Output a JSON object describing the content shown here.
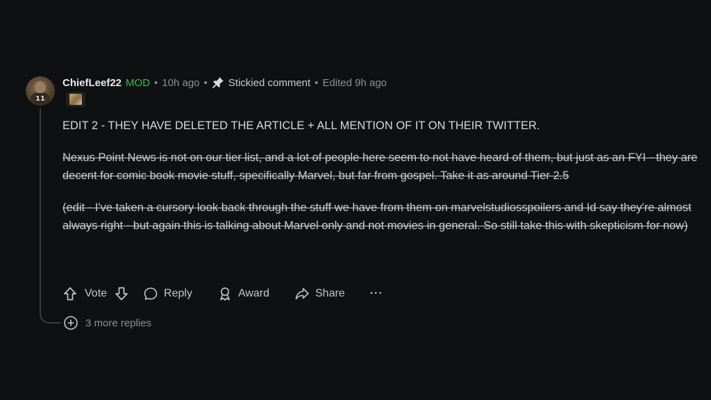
{
  "comment": {
    "author": "ChiefLeef22",
    "role_badge": "MOD",
    "time_ago": "10h ago",
    "stickied_label": "Stickied comment",
    "edited": "Edited 9h ago",
    "separator": "•",
    "paragraphs": [
      "EDIT 2 - THEY HAVE DELETED THE ARTICLE + ALL MENTION OF IT ON THEIR TWITTER.",
      "Nexus Point News is not on our tier list, and a lot of people here seem to not have heard of them, but just as an FYI - they are decent for comic book movie stuff, specifically Marvel, but far from gospel. Take it as around Tier 2.5",
      "(edit - I've taken a cursory look back through the stuff we have from them on marvelstudiosspoilers and Id say they're almost always right - but again this is talking about Marvel only and not movies in general. So still take this with skepticism for now)"
    ]
  },
  "actions": {
    "vote_label": "Vote",
    "reply_label": "Reply",
    "award_label": "Award",
    "share_label": "Share",
    "more_label": "···"
  },
  "replies": {
    "label": "3 more replies"
  },
  "colors": {
    "background": "#0f1012",
    "mod_green": "#3cbf4a",
    "muted_text": "#8d9296"
  },
  "icons": [
    "avatar",
    "pin-icon",
    "flair-icon",
    "upvote-icon",
    "downvote-icon",
    "reply-icon",
    "award-icon",
    "share-icon",
    "more-icon",
    "expand-replies-icon"
  ]
}
